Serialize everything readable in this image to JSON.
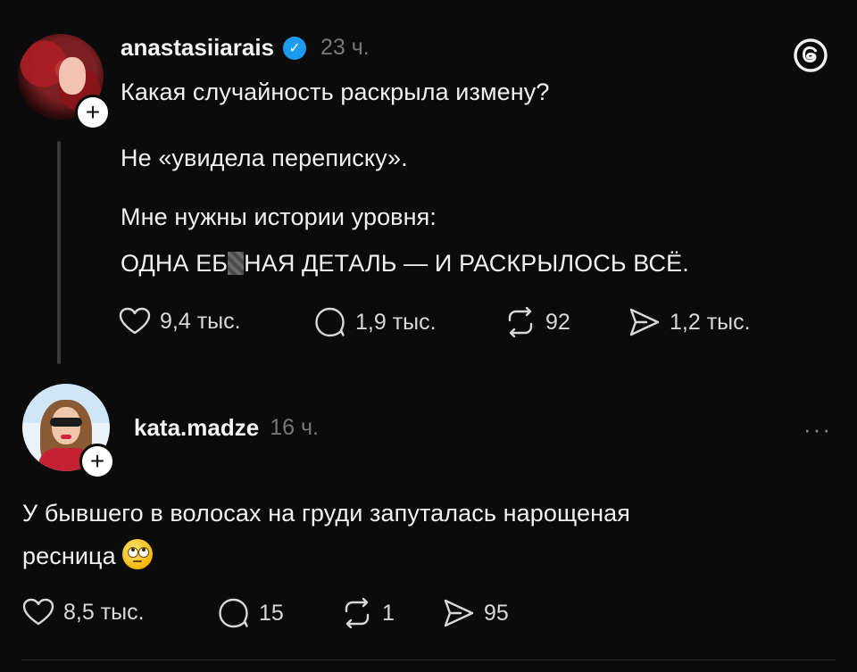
{
  "post1": {
    "username": "anastasiiarais",
    "verified_mark": "✓",
    "time": "23 ч.",
    "plus": "+",
    "lines": [
      "Какая случайность раскрыла измену?",
      "Не «увидела переписку».",
      "Мне нужны истории уровня:",
      "НАЯ ДЕТАЛЬ — И РАСКРЫЛОСЬ ВСЁ."
    ],
    "censored_prefix": "ОДНА ЕБ",
    "actions": {
      "likes": "9,4 тыс.",
      "comments": "1,9 тыс.",
      "reposts": "92",
      "shares": "1,2 тыс."
    }
  },
  "post2": {
    "username": "kata.madze",
    "time": "16 ч.",
    "plus": "+",
    "more": "···",
    "lines": [
      "У бывшего в волосах на груди запуталась нарощеная",
      "ресница"
    ],
    "emoji_name": "face-with-rolling-eyes",
    "actions": {
      "likes": "8,5 тыс.",
      "comments": "15",
      "reposts": "1",
      "shares": "95"
    }
  },
  "icons": {
    "brand": "threads-logo",
    "like": "heart-icon",
    "comment": "comment-bubble-icon",
    "repost": "repost-icon",
    "share": "send-icon"
  },
  "colors": {
    "background": "#0b0b0b",
    "text": "#f1f1f1",
    "muted": "#777777",
    "verified": "#1d9bf0"
  }
}
